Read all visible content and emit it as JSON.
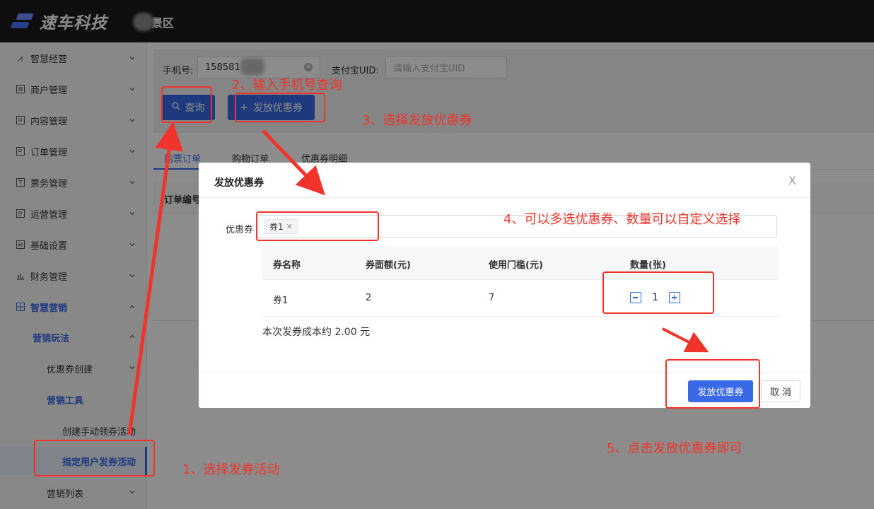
{
  "header": {
    "brand": "速车科技",
    "site_suffix": "景区"
  },
  "sidebar": {
    "items": [
      {
        "label": "智慧经营",
        "icon": "trend-icon"
      },
      {
        "label": "商户管理",
        "icon": "list-icon"
      },
      {
        "label": "内容管理",
        "icon": "document-icon"
      },
      {
        "label": "订单管理",
        "icon": "order-icon"
      },
      {
        "label": "票务管理",
        "icon": "ticket-icon"
      },
      {
        "label": "运营管理",
        "icon": "operation-icon"
      },
      {
        "label": "基础设置",
        "icon": "settings-grid-icon"
      },
      {
        "label": "财务管理",
        "icon": "bar-chart-icon"
      },
      {
        "label": "智慧营销",
        "icon": "grid-icon"
      }
    ],
    "marketing_play": "营销玩法",
    "coupon_create": "优惠券创建",
    "marketing_tools": "营销工具",
    "create_manual_activity": "创建手动领券活动",
    "assign_user_activity": "指定用户发券活动",
    "marketing_list": "营销列表"
  },
  "search": {
    "phone_label": "手机号:",
    "phone_value": "158581",
    "alipay_label": "支付宝UID:",
    "alipay_placeholder": "请输入支付宝UID",
    "query_button": "查询",
    "issue_button": "发放优惠券"
  },
  "tabs": [
    "购票订单",
    "购物订单",
    "优惠券明细"
  ],
  "table": {
    "first_column": "订单编号"
  },
  "modal": {
    "title": "发放优惠券",
    "close": "X",
    "coupon_label": "优惠券",
    "selected_tag": "券1",
    "columns": [
      "券名称",
      "券面额(元)",
      "使用门槛(元)",
      "数量(张)"
    ],
    "rows": [
      {
        "name": "券1",
        "face_value": "2",
        "threshold": "7",
        "quantity": "1"
      }
    ],
    "cost_note": "本次发券成本约 2.00 元",
    "issue_button": "发放优惠券",
    "cancel_button": "取 消"
  },
  "annotations": {
    "step1": "1、选择发券活动",
    "step2": "2、输入手机号查询",
    "step3": "3、选择发放优惠券",
    "step4": "4、可以多选优惠券、数量可以自定义选择",
    "step5": "5、点击发放优惠券即可"
  },
  "colors": {
    "primary": "#3a69e8",
    "annotation_red": "#f0342b",
    "topbar": "#1b1b1b"
  }
}
